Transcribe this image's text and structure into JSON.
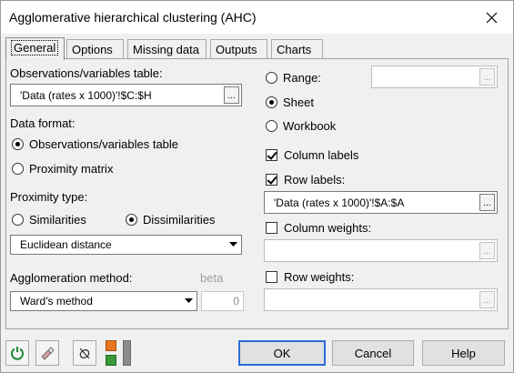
{
  "window": {
    "title": "Agglomerative hierarchical clustering (AHC)"
  },
  "tabs": [
    {
      "label": "General"
    },
    {
      "label": "Options"
    },
    {
      "label": "Missing data"
    },
    {
      "label": "Outputs"
    },
    {
      "label": "Charts"
    }
  ],
  "general": {
    "obs_table_label": "Observations/variables table:",
    "obs_table_value": "'Data (rates x 1000)'!$C:$H",
    "data_format_label": "Data format:",
    "data_format_options": [
      "Observations/variables table",
      "Proximity matrix"
    ],
    "data_format_selected": "Observations/variables table",
    "proximity_type_label": "Proximity type:",
    "proximity_options": [
      "Similarities",
      "Dissimilarities"
    ],
    "proximity_selected": "Dissimilarities",
    "distance_value": "Euclidean distance",
    "agglomeration_label": "Agglomeration method:",
    "beta_label": "beta",
    "agglomeration_value": "Ward's method",
    "beta_value": "0",
    "output_options": [
      "Range:",
      "Sheet",
      "Workbook"
    ],
    "output_selected": "Sheet",
    "range_value": "",
    "column_labels": {
      "label": "Column labels",
      "checked": true
    },
    "row_labels": {
      "label": "Row labels:",
      "checked": true
    },
    "row_labels_value": "'Data (rates x 1000)'!$A:$A",
    "column_weights": {
      "label": "Column weights:",
      "checked": false
    },
    "row_weights": {
      "label": "Row weights:",
      "checked": false
    },
    "browse_glyph": "..."
  },
  "buttons": {
    "ok": "OK",
    "cancel": "Cancel",
    "help": "Help"
  },
  "icons": [
    "reset-icon",
    "eraser-icon",
    "hide-dialog-icon",
    "color-options-icon"
  ],
  "colors": {
    "accent": "#2b6cd8",
    "reset_green": "#1e8a3a",
    "orange": "#e8761e",
    "green": "#3a9a3a"
  }
}
